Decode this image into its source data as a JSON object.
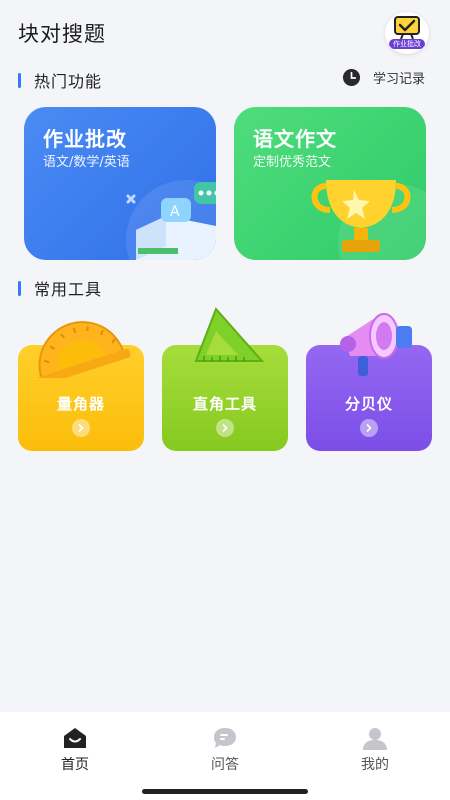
{
  "header": {
    "title": "块对搜题",
    "avatar_badge": "作业批改"
  },
  "hot_section": {
    "title": "热门功能",
    "history_label": "学习记录",
    "history_icon": "clock-icon",
    "cards": [
      {
        "title": "作业批改",
        "subtitle": "语文/数学/英语",
        "color": "#3579ef"
      },
      {
        "title": "语文作文",
        "subtitle": "定制优秀范文",
        "color": "#36d06f"
      }
    ]
  },
  "tools_section": {
    "title": "常用工具",
    "tools": [
      {
        "label": "量角器",
        "icon": "protractor-icon",
        "color": "#fdc417"
      },
      {
        "label": "直角工具",
        "icon": "set-square-icon",
        "color": "#95d22c"
      },
      {
        "label": "分贝仪",
        "icon": "megaphone-icon",
        "color": "#8759ec"
      }
    ]
  },
  "tabbar": {
    "tabs": [
      {
        "label": "首页",
        "icon": "home-icon",
        "active": true
      },
      {
        "label": "问答",
        "icon": "chat-icon",
        "active": false
      },
      {
        "label": "我的",
        "icon": "profile-icon",
        "active": false
      }
    ]
  }
}
